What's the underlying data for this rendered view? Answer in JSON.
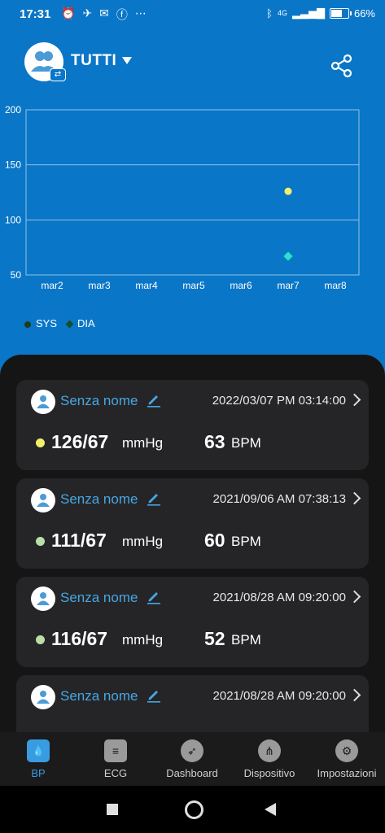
{
  "status_bar": {
    "time": "17:31",
    "network": "4G",
    "battery": "66%"
  },
  "header": {
    "title": "TUTTI"
  },
  "chart_data": {
    "type": "scatter",
    "x_categories": [
      "mar2",
      "mar3",
      "mar4",
      "mar5",
      "mar6",
      "mar7",
      "mar8"
    ],
    "y_ticks": [
      200,
      150,
      100,
      50
    ],
    "ylim": [
      50,
      200
    ],
    "grid": true,
    "series": [
      {
        "name": "SYS",
        "color": "#f2f06a",
        "marker": "circle",
        "points": [
          {
            "x": "mar7",
            "y": 126
          }
        ]
      },
      {
        "name": "DIA",
        "color": "#27e3c8",
        "marker": "diamond",
        "points": [
          {
            "x": "mar7",
            "y": 67
          }
        ]
      }
    ],
    "legend": "bottom-left"
  },
  "records": [
    {
      "name": "Senza nome",
      "datetime": "2022/03/07 PM 03:14:00",
      "bp": "126/67",
      "bp_unit": "mmHg",
      "hr": "63",
      "hr_unit": "BPM",
      "dot_color": "#f2f06a"
    },
    {
      "name": "Senza nome",
      "datetime": "2021/09/06 AM 07:38:13",
      "bp": "111/67",
      "bp_unit": "mmHg",
      "hr": "60",
      "hr_unit": "BPM",
      "dot_color": "#b8e0a6"
    },
    {
      "name": "Senza nome",
      "datetime": "2021/08/28 AM 09:20:00",
      "bp": "116/67",
      "bp_unit": "mmHg",
      "hr": "52",
      "hr_unit": "BPM",
      "dot_color": "#b8e0a6"
    },
    {
      "name": "Senza nome",
      "datetime": "2021/08/28 AM 09:20:00",
      "bp": "",
      "bp_unit": "",
      "hr": "",
      "hr_unit": "",
      "dot_color": "#b8e0a6"
    }
  ],
  "nav": [
    {
      "label": "BP",
      "icon": "bp-icon",
      "active": true
    },
    {
      "label": "ECG",
      "icon": "ecg-icon",
      "active": false
    },
    {
      "label": "Dashboard",
      "icon": "compass-icon",
      "active": false
    },
    {
      "label": "Dispositivo",
      "icon": "device-icon",
      "active": false
    },
    {
      "label": "Impostazioni",
      "icon": "gear-icon",
      "active": false
    }
  ]
}
